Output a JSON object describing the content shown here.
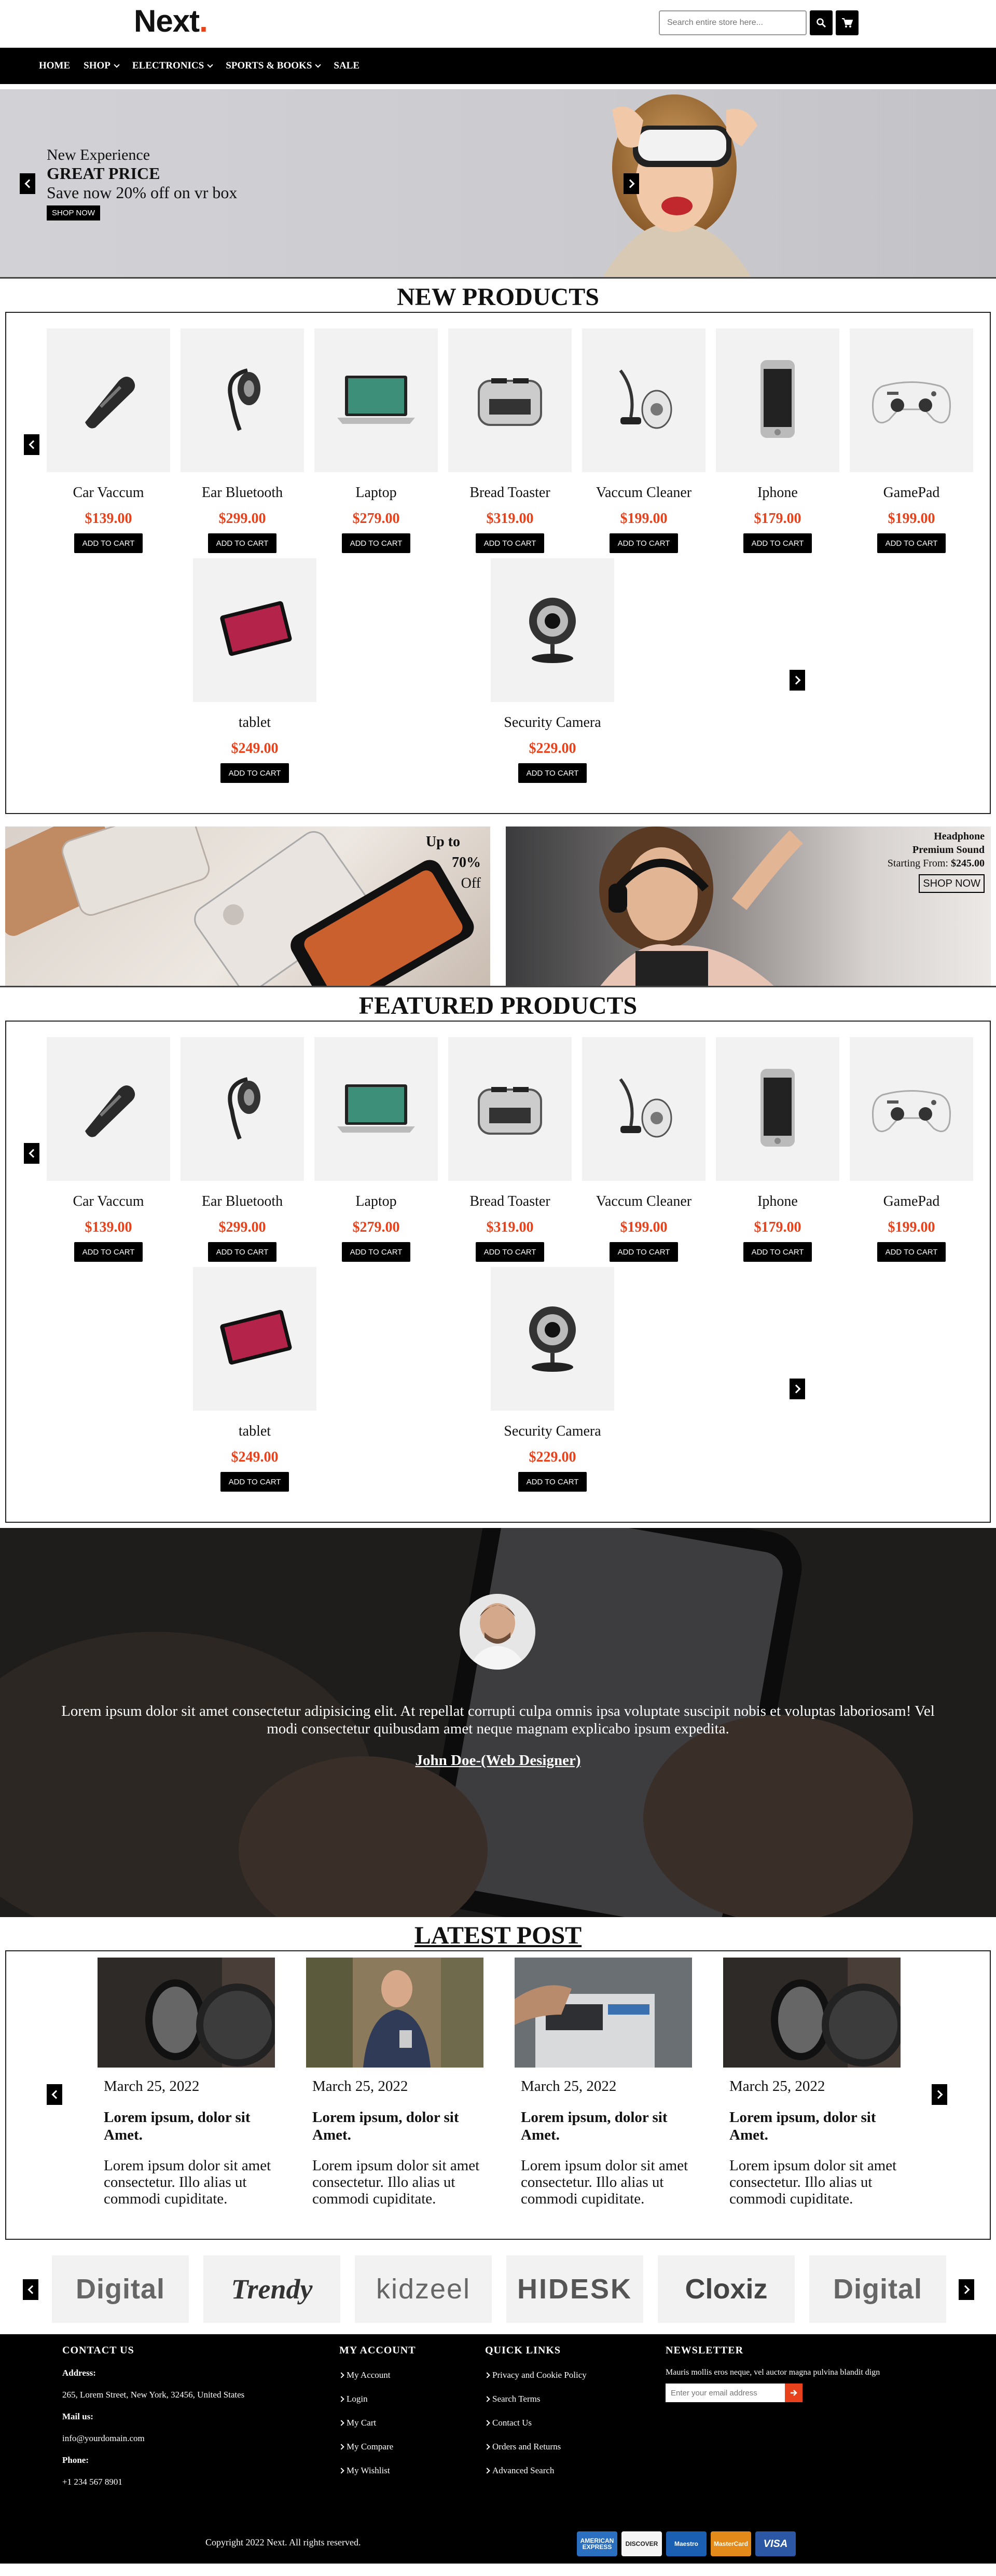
{
  "header": {
    "logo_text": "Next",
    "logo_dot": ".",
    "search_placeholder": "Search entire store here..."
  },
  "nav": {
    "items": [
      {
        "label": "HOME",
        "dropdown": false
      },
      {
        "label": "SHOP",
        "dropdown": true
      },
      {
        "label": "ELECTRONICS",
        "dropdown": true
      },
      {
        "label": "SPORTS & BOOKS",
        "dropdown": true
      },
      {
        "label": "SALE",
        "dropdown": false
      }
    ]
  },
  "hero": {
    "subtitle": "New Experience",
    "title": "GREAT PRICE",
    "offer": "Save now 20% off on vr box",
    "button": "SHOP NOW"
  },
  "new_products": {
    "title": "NEW PRODUCTS",
    "items": [
      {
        "name": "Car Vaccum",
        "price": "$139.00",
        "icon": "car-vacuum"
      },
      {
        "name": "Ear Bluetooth",
        "price": "$299.00",
        "icon": "bluetooth-headset"
      },
      {
        "name": "Laptop",
        "price": "$279.00",
        "icon": "laptop"
      },
      {
        "name": "Bread Toaster",
        "price": "$319.00",
        "icon": "toaster"
      },
      {
        "name": "Vaccum Cleaner",
        "price": "$199.00",
        "icon": "vacuum-cleaner"
      },
      {
        "name": "Iphone",
        "price": "$179.00",
        "icon": "iphone"
      },
      {
        "name": "GamePad",
        "price": "$199.00",
        "icon": "gamepad"
      },
      {
        "name": "tablet",
        "price": "$249.00",
        "icon": "tablet"
      },
      {
        "name": "Security Camera",
        "price": "$229.00",
        "icon": "webcam"
      }
    ],
    "cart_label": "ADD TO CART"
  },
  "banners": {
    "left": {
      "line1": "Up to",
      "line2": "70%",
      "line3": "Off"
    },
    "right": {
      "line1": "Headphone",
      "line2": "Premium Sound",
      "starting_label": "Starting From:",
      "starting_price": "$245.00",
      "button": "SHOP NOW"
    }
  },
  "featured_products": {
    "title": "FEATURED PRODUCTS",
    "items": [
      {
        "name": "Car Vaccum",
        "price": "$139.00",
        "icon": "car-vacuum"
      },
      {
        "name": "Ear Bluetooth",
        "price": "$299.00",
        "icon": "bluetooth-headset"
      },
      {
        "name": "Laptop",
        "price": "$279.00",
        "icon": "laptop"
      },
      {
        "name": "Bread Toaster",
        "price": "$319.00",
        "icon": "toaster"
      },
      {
        "name": "Vaccum Cleaner",
        "price": "$199.00",
        "icon": "vacuum-cleaner"
      },
      {
        "name": "Iphone",
        "price": "$179.00",
        "icon": "iphone"
      },
      {
        "name": "GamePad",
        "price": "$199.00",
        "icon": "gamepad"
      },
      {
        "name": "tablet",
        "price": "$249.00",
        "icon": "tablet"
      },
      {
        "name": "Security Camera",
        "price": "$229.00",
        "icon": "webcam"
      }
    ],
    "cart_label": "ADD TO CART"
  },
  "testimonial": {
    "quote": "Lorem ipsum dolor sit amet consectetur adipisicing elit. At repellat corrupti culpa omnis ipsa voluptate suscipit nobis et voluptas laboriosam! Vel modi consectetur quibusdam amet neque magnam explicabo ipsum expedita.",
    "author": "John Doe-(Web Designer)"
  },
  "latest_post": {
    "title": "LATEST POST",
    "posts": [
      {
        "date": "March 25, 2022",
        "title": "Lorem ipsum, dolor sit Amet.",
        "text": "Lorem ipsum dolor sit amet consectetur. Illo alias ut commodi cupiditate.",
        "image": "microphone"
      },
      {
        "date": "March 25, 2022",
        "title": "Lorem ipsum, dolor sit Amet.",
        "text": "Lorem ipsum dolor sit amet consectetur. Illo alias ut commodi cupiditate.",
        "image": "man-phone"
      },
      {
        "date": "March 25, 2022",
        "title": "Lorem ipsum, dolor sit Amet.",
        "text": "Lorem ipsum dolor sit amet consectetur. Illo alias ut commodi cupiditate.",
        "image": "printer"
      },
      {
        "date": "March 25, 2022",
        "title": "Lorem ipsum, dolor sit Amet.",
        "text": "Lorem ipsum dolor sit amet consectetur. Illo alias ut commodi cupiditate.",
        "image": "microphone"
      }
    ]
  },
  "brands": [
    "Digital",
    "Trendy",
    "kidzeel",
    "HIDESK",
    "Cloxiz",
    "Digital"
  ],
  "footer": {
    "contact": {
      "title": "CONTACT US",
      "address_label": "Address:",
      "address": "265, Lorem Street, New York, 32456, United States",
      "mail_label": "Mail us:",
      "mail": "info@yourdomain.com",
      "phone_label": "Phone:",
      "phone": "+1 234 567 8901"
    },
    "account": {
      "title": "MY ACCOUNT",
      "links": [
        "My Account",
        "Login",
        "My Cart",
        "My Compare",
        "My Wishlist"
      ]
    },
    "quick": {
      "title": "QUICK LINKS",
      "links": [
        "Privacy and Cookie Policy",
        "Search Terms",
        "Contact Us",
        "Orders and Returns",
        "Advanced Search"
      ]
    },
    "newsletter": {
      "title": "NEWSLETTER",
      "text": "Mauris mollis eros neque, vel auctor magna pulvina blandit dign",
      "placeholder": "Enter your email address"
    },
    "copyright": "Copyright 2022 Next. All rights reserved.",
    "cards": [
      "AMERICAN EXPRESS",
      "DISCOVER",
      "Maestro",
      "MasterCard",
      "VISA"
    ]
  },
  "colors": {
    "accent": "#e8421c",
    "dark": "#000000",
    "card_bg": "#f2f2f2"
  }
}
